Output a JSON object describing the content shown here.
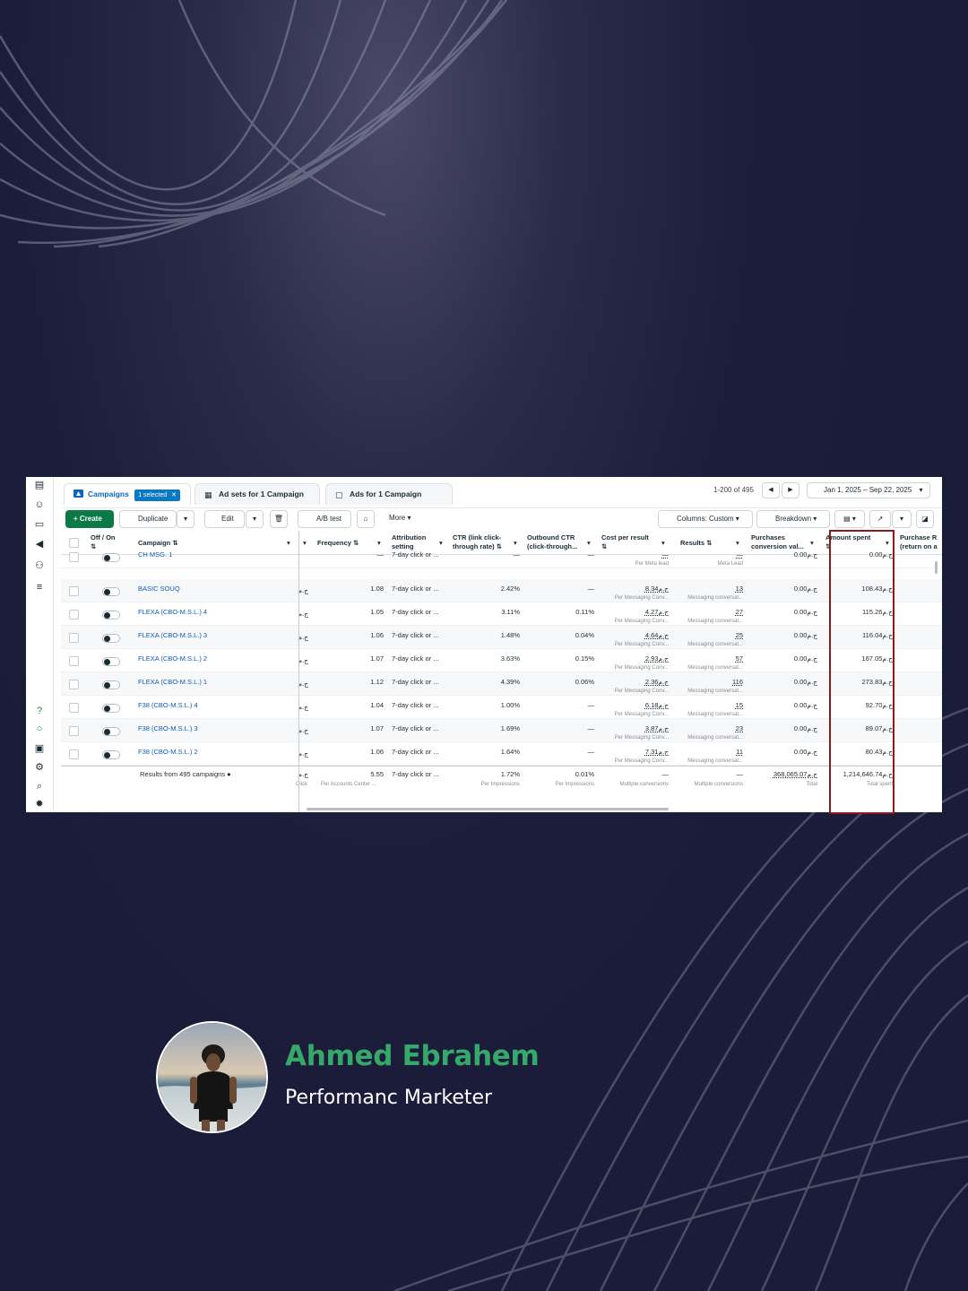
{
  "tabs": {
    "campaigns": "Campaigns",
    "selected": "1 selected",
    "adsets": "Ad sets for 1 Campaign",
    "ads": "Ads for 1 Campaign"
  },
  "pager": {
    "range": "1-200 of 495",
    "prev": "◀",
    "next": "▶"
  },
  "date_range": "Jan 1, 2025 – Sep 22, 2025",
  "toolbar": {
    "create": "+ Create",
    "duplicate": "Duplicate",
    "edit": "Edit",
    "ab_test": "A/B test",
    "more": "More",
    "columns": "Columns: Custom",
    "breakdown": "Breakdown"
  },
  "headers": {
    "offon": "Off / On\n⇅",
    "campaign": "Campaign ⇅",
    "frequency": "Frequency ⇅",
    "attribution": "Attribution\nsetting",
    "ctr": "CTR (link click-\nthrough rate) ⇅",
    "outbound": "Outbound CTR\n(click-through...",
    "cpr": "Cost per result\n⇅",
    "results": "Results ⇅",
    "purchases": "Purchases\nconversion val...",
    "amount": "Amount spent\n⇅",
    "roas": "Purchase R\n(return on a"
  },
  "currency": "ج.م",
  "rows": [
    {
      "name": "CH MSG. 1",
      "lead": "",
      "freq": "—",
      "attr": "7-day click or ...",
      "ctr": "—",
      "out": "—",
      "cpr": "—",
      "cpr_sub": "Per Meta lead",
      "res": "—",
      "res_sub": "Meta Lead",
      "purch": "0.00ج.م",
      "spent": "0.00ج.م"
    },
    {
      "name": "BASIC SOUQ",
      "lead": "ج.م",
      "freq": "1.08",
      "attr": "7-day click or ...",
      "ctr": "2.42%",
      "out": "—",
      "cpr": "8.34ج.م",
      "cpr_sub": "Per Messaging Conv...",
      "res": "13",
      "res_sub": "Messaging conversat...",
      "purch": "0.00ج.م",
      "spent": "108.43ج.م"
    },
    {
      "name": "FLEXA (CBO-M.S.L.) 4",
      "lead": "ج.م",
      "freq": "1.05",
      "attr": "7-day click or ...",
      "ctr": "3.11%",
      "out": "0.11%",
      "cpr": "4.27ج.م",
      "cpr_sub": "Per Messaging Conv...",
      "res": "27",
      "res_sub": "Messaging conversat...",
      "purch": "0.00ج.م",
      "spent": "115.26ج.م"
    },
    {
      "name": "FLEXA (CBO-M.S.L.) 3",
      "lead": "ج.م",
      "freq": "1.06",
      "attr": "7-day click or ...",
      "ctr": "1.48%",
      "out": "0.04%",
      "cpr": "4.64ج.م",
      "cpr_sub": "Per Messaging Conv...",
      "res": "25",
      "res_sub": "Messaging conversat...",
      "purch": "0.00ج.م",
      "spent": "116.04ج.م"
    },
    {
      "name": "FLEXA (CBO-M.S.L.) 2",
      "lead": "ج.م",
      "freq": "1.07",
      "attr": "7-day click or ...",
      "ctr": "3.63%",
      "out": "0.15%",
      "cpr": "2.93ج.م",
      "cpr_sub": "Per Messaging Conv...",
      "res": "57",
      "res_sub": "Messaging conversat...",
      "purch": "0.00ج.م",
      "spent": "167.05ج.م"
    },
    {
      "name": "FLEXA (CBO-M.S.L.) 1",
      "lead": "ج.م",
      "freq": "1.12",
      "attr": "7-day click or ...",
      "ctr": "4.39%",
      "out": "0.06%",
      "cpr": "2.36ج.م",
      "cpr_sub": "Per Messaging Conv...",
      "res": "116",
      "res_sub": "Messaging conversat...",
      "purch": "0.00ج.م",
      "spent": "273.83ج.م"
    },
    {
      "name": "F38 (CBO-M.S.L.) 4",
      "lead": "ج.م",
      "freq": "1.04",
      "attr": "7-day click or ...",
      "ctr": "1.00%",
      "out": "—",
      "cpr": "6.18ج.م",
      "cpr_sub": "Per Messaging Conv...",
      "res": "15",
      "res_sub": "Messaging conversat...",
      "purch": "0.00ج.م",
      "spent": "92.70ج.م"
    },
    {
      "name": "F38 (CBO-M.S.L.) 3",
      "lead": "ج.م",
      "freq": "1.07",
      "attr": "7-day click or ...",
      "ctr": "1.69%",
      "out": "—",
      "cpr": "3.87ج.م",
      "cpr_sub": "Per Messaging Conv...",
      "res": "23",
      "res_sub": "Messaging conversat...",
      "purch": "0.00ج.م",
      "spent": "89.07ج.م"
    },
    {
      "name": "F38 (CBO-M.S.L.) 2",
      "lead": "ج.م",
      "freq": "1.06",
      "attr": "7-day click or ...",
      "ctr": "1.64%",
      "out": "—",
      "cpr": "7.31ج.م",
      "cpr_sub": "Per Messaging Conv...",
      "res": "11",
      "res_sub": "Messaging conversat...",
      "purch": "0.00ج.م",
      "spent": "80.43ج.م"
    }
  ],
  "totals": {
    "label": "Results from 495 campaigns",
    "lead": "ج.م",
    "lead_sub": "Click",
    "freq": "5.55",
    "freq_sub": "Per Accounts Center ...",
    "attr": "7-day click or ...",
    "ctr": "1.72%",
    "ctr_sub": "Per Impressions",
    "out": "0.01%",
    "out_sub": "Per Impressions",
    "cpr": "—",
    "cpr_sub": "Multiple conversions",
    "res": "—",
    "res_sub": "Multiple conversions",
    "purch": "368,065.07ج.م",
    "purch_sub": "Total",
    "spent": "1,214,646.74ج.م",
    "spent_sub": "Total spent"
  },
  "profile": {
    "name": "Ahmed Ebrahem",
    "role": "Performanc Marketer"
  },
  "colors": {
    "background": "#1b1d3a",
    "name_green": "#36a86a",
    "highlight": "#8e1b1b",
    "create_green": "#0b7a46",
    "link_blue": "#0a5cb8"
  }
}
